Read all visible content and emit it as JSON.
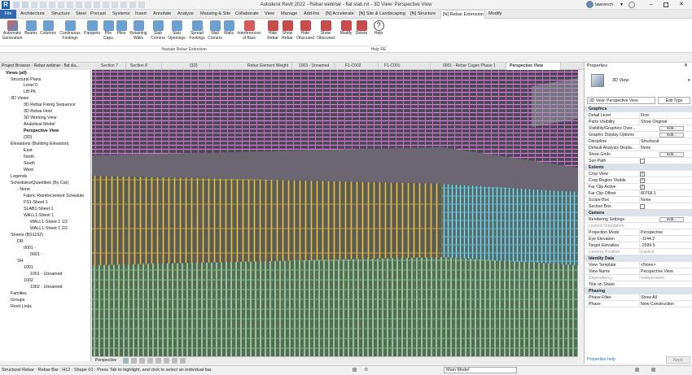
{
  "app": {
    "title": "Autodesk Revit 2022 - Rebar webinar - flat slab.rvt - 3D View: Perspective View",
    "user": "lawrench"
  },
  "colors": {
    "file_tab": "#2d6ab0",
    "accent": "#2d6ab0",
    "rebar_top": "#d06fd6",
    "rebar_mid": "#f0c43a",
    "rebar_low": "#8fd3a3",
    "rebar_right": "#7fd6e6"
  },
  "ribbon_tabs": [
    "File",
    "Architecture",
    "Structure",
    "Steel",
    "Precast",
    "Systems",
    "Insert",
    "Annotate",
    "Analyze",
    "Massing & Site",
    "Collaborate",
    "View",
    "Manage",
    "Add-Ins",
    "[N] Accelerate",
    "[N] Site & Landscaping",
    "[N] Structure",
    "[N] Rebar Extension",
    "Modify"
  ],
  "ribbon_active": "[N] Rebar Extension",
  "ribbon_buttons": [
    {
      "label": "Automatic Generation",
      "icon": "auto-generation-icon"
    },
    {
      "label": "Beams",
      "icon": "beam-icon"
    },
    {
      "label": "Columns",
      "icon": "column-icon"
    },
    {
      "label": "Continuous Footings",
      "icon": "footing-icon"
    },
    {
      "label": "Parapets",
      "icon": "parapet-icon"
    },
    {
      "label": "Pile Caps",
      "icon": "pile-cap-icon"
    },
    {
      "label": "Piles",
      "icon": "pile-icon"
    },
    {
      "label": "Retaining Walls",
      "icon": "retaining-wall-icon"
    },
    {
      "label": "Slab Corners",
      "icon": "slab-corner-icon"
    },
    {
      "label": "Slab Openings",
      "icon": "slab-opening-icon"
    },
    {
      "label": "Spread Footings",
      "icon": "spread-footing-icon"
    },
    {
      "label": "Wall Corners",
      "icon": "wall-corner-icon"
    },
    {
      "label": "Walls",
      "icon": "wall-icon"
    },
    {
      "label": "Interferences of Bars",
      "icon": "interference-icon"
    },
    {
      "label": "Hide Rebar",
      "icon": "hide-rebar-icon"
    },
    {
      "label": "Show Rebar",
      "icon": "show-rebar-icon"
    },
    {
      "label": "Hide Obscured",
      "icon": "hide-obscured-icon"
    },
    {
      "label": "Show Obscured",
      "icon": "show-obscured-icon"
    },
    {
      "label": "Modify",
      "icon": "modify-icon"
    },
    {
      "label": "Delete",
      "icon": "delete-icon"
    },
    {
      "label": "Help",
      "icon": "help-icon"
    }
  ],
  "ribbon_panels": [
    "Naviate Rebar Extension",
    "Help RE"
  ],
  "project_browser": {
    "title": "Project Browser - Rebar webinar - flat sla...",
    "items": [
      "Views (all)",
      "Structural Plans",
      "Level 0",
      "Lift Pit",
      "3D Views",
      "3D Rebar Fixing Sequence",
      "3D Rebar Host",
      "3D Working View",
      "Analytical Model",
      "Perspective View",
      "{3D}",
      "Elevations (Building Elevation)",
      "East",
      "North",
      "South",
      "West",
      "Legends",
      "Schedules/Quantities (By Cat)",
      "- None",
      "Fabric Reinforcement Schedule",
      "FS1-Sheet 1",
      "SLAB1-Sheet 1",
      "WALL1-Sheet 1",
      "WALL1-Sheet 1 1/2",
      "WALL1-Sheet 1 2/2",
      "Sheets (BS1192)",
      "DR",
      "0001 -",
      "0001 -",
      "SH",
      "1001",
      "1001 - Unnamed",
      "1002",
      "1002 - Unnamed",
      "Families",
      "Groups",
      "Revit Links"
    ]
  },
  "view_tabs": [
    "Section 7",
    "Section 8",
    "{3D}",
    "Rebar Element Weight",
    "1003 - Unnamed",
    "F1-C002",
    "F1-C001",
    "0001 - Rebar Cages Phase 1",
    "Perspective View"
  ],
  "view_control": {
    "label": "Perspective"
  },
  "properties": {
    "title": "Properties",
    "type_name": "3D View",
    "selector": "3D View: Perspective View",
    "edit_type": "Edit Type",
    "sections": [
      {
        "name": "Graphics",
        "rows": [
          [
            "Detail Level",
            "Fine"
          ],
          [
            "Parts Visibility",
            "Show Original"
          ],
          [
            "Visibility/Graphics Over...",
            "Edit..."
          ],
          [
            "Graphic Display Options",
            "Edit..."
          ],
          [
            "Discipline",
            "Structural"
          ],
          [
            "Default Analysis Displa...",
            "None"
          ],
          [
            "Show Grids",
            "Edit..."
          ],
          [
            "Sun Path",
            "chk:false"
          ]
        ]
      },
      {
        "name": "Extents",
        "rows": [
          [
            "Crop View",
            "chk:true"
          ],
          [
            "Crop Region Visible",
            "chk:true"
          ],
          [
            "Far Clip Active",
            "chk:true"
          ],
          [
            "Far Clip Offset",
            "80768.1"
          ],
          [
            "Scope Box",
            "None"
          ],
          [
            "Section Box",
            "chk:false"
          ]
        ]
      },
      {
        "name": "Camera",
        "rows": [
          [
            "Rendering Settings",
            "Edit..."
          ],
          [
            "Locked Orientation",
            "grey:"
          ],
          [
            "Projection Mode",
            "Perspective"
          ],
          [
            "Eye Elevation",
            "-1144.2"
          ],
          [
            "Target Elevation",
            "-2599.5"
          ],
          [
            "Camera Position",
            "grey:Explicit"
          ]
        ]
      },
      {
        "name": "Identity Data",
        "rows": [
          [
            "View Template",
            "<None>"
          ],
          [
            "View Name",
            "Perspective View"
          ],
          [
            "Dependency",
            "grey:Independent"
          ],
          [
            "Title on Sheet",
            ""
          ]
        ]
      },
      {
        "name": "Phasing",
        "rows": [
          [
            "Phase Filter",
            "Show All"
          ],
          [
            "Phase",
            "New Construction"
          ]
        ]
      }
    ],
    "help": "Properties help",
    "apply": "Apply"
  },
  "status": {
    "text": "Structural Rebar : Rebar Bar : H12 : Shape 01 : Press Tab to highlight, and click to select an individual bar.",
    "model": "Main Model",
    "coord": ":0"
  }
}
